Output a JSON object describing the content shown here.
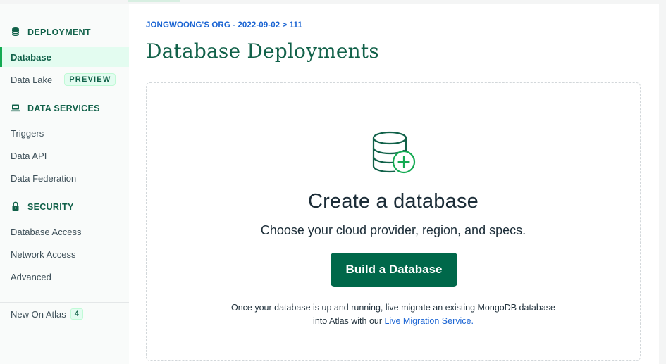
{
  "sidebar": {
    "deployment": {
      "heading": "DEPLOYMENT",
      "items": [
        {
          "label": "Database",
          "active": true
        },
        {
          "label": "Data Lake",
          "badge": "PREVIEW"
        }
      ]
    },
    "data_services": {
      "heading": "DATA SERVICES",
      "items": [
        {
          "label": "Triggers"
        },
        {
          "label": "Data API"
        },
        {
          "label": "Data Federation"
        }
      ]
    },
    "security": {
      "heading": "SECURITY",
      "items": [
        {
          "label": "Database Access"
        },
        {
          "label": "Network Access"
        },
        {
          "label": "Advanced"
        }
      ]
    },
    "new_on_atlas": {
      "label": "New On Atlas",
      "count": "4"
    }
  },
  "main": {
    "breadcrumb": "JONGWOONG'S ORG - 2022-09-02 > 111",
    "title": "Database Deployments",
    "empty_state": {
      "icon": "database-add-icon",
      "title": "Create a database",
      "subtitle": "Choose your cloud provider, region, and specs.",
      "button_label": "Build a Database",
      "footnote_line1": "Once your database is up and running, live migrate an existing MongoDB database",
      "footnote_line2_prefix": "into Atlas with our ",
      "footnote_link": "Live Migration Service."
    }
  },
  "colors": {
    "brand_green": "#00684a",
    "heading_green": "#116149",
    "link_blue": "#1a64d3",
    "active_bg": "#e3fcf0"
  }
}
